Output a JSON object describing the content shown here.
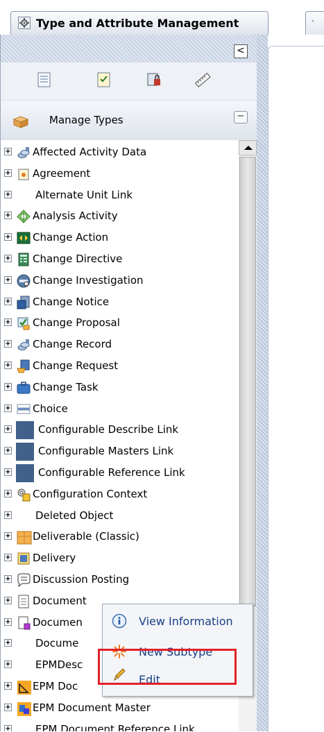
{
  "tab": {
    "title": "Type and Attribute Management",
    "second_tab_glyph": "·"
  },
  "panel": {
    "collapse_glyph": "<",
    "toolbar_icons": [
      "list-icon",
      "checklist-icon",
      "lock-document-icon",
      "ruler-icon"
    ],
    "section_title": "Manage Types",
    "section_toggle": "−"
  },
  "tree": {
    "items": [
      {
        "label": "Affected Activity Data",
        "icon": "link-icon"
      },
      {
        "label": "Agreement",
        "icon": "agreement-icon"
      },
      {
        "label": "Alternate Unit Link",
        "icon": ""
      },
      {
        "label": "Analysis Activity",
        "icon": "analysis-icon"
      },
      {
        "label": "Change Action",
        "icon": "change-action-icon"
      },
      {
        "label": "Change Directive",
        "icon": "change-directive-icon"
      },
      {
        "label": "Change Investigation",
        "icon": "investigation-icon"
      },
      {
        "label": "Change Notice",
        "icon": "notice-icon"
      },
      {
        "label": "Change Proposal",
        "icon": "proposal-icon"
      },
      {
        "label": "Change Record",
        "icon": "link-icon"
      },
      {
        "label": "Change Request",
        "icon": "request-icon"
      },
      {
        "label": "Change Task",
        "icon": "task-icon"
      },
      {
        "label": "Choice",
        "icon": "choice-icon"
      },
      {
        "label": "Configurable Describe Link",
        "icon": "square-icon"
      },
      {
        "label": "Configurable Masters Link",
        "icon": "square-icon"
      },
      {
        "label": "Configurable Reference Link",
        "icon": "square-icon"
      },
      {
        "label": "Configuration Context",
        "icon": "config-icon"
      },
      {
        "label": "Deleted Object",
        "icon": ""
      },
      {
        "label": "Deliverable (Classic)",
        "icon": "deliverable-icon"
      },
      {
        "label": "Delivery",
        "icon": "delivery-icon"
      },
      {
        "label": "Discussion Posting",
        "icon": "discussion-icon"
      },
      {
        "label": "Document",
        "icon": "document-icon"
      },
      {
        "label": "Documen",
        "icon": "document-color-icon"
      },
      {
        "label": "Docume",
        "icon": ""
      },
      {
        "label": "EPMDesc",
        "icon": ""
      },
      {
        "label": "EPM Doc",
        "icon": "epm-doc-icon"
      },
      {
        "label": "EPM Document Master",
        "icon": "epm-master-icon"
      },
      {
        "label": "EPM Document Reference Link",
        "icon": ""
      }
    ]
  },
  "context_menu": {
    "items": [
      {
        "label": "View Information",
        "icon": "info-icon"
      },
      {
        "label": "New Subtype",
        "icon": "new-star-icon"
      },
      {
        "label": "Edit",
        "icon": "pencil-icon"
      }
    ],
    "highlighted": "New Subtype",
    "highlight_color": "#e32027"
  }
}
